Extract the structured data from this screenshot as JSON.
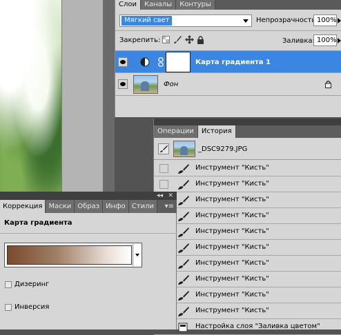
{
  "layers_panel": {
    "tabs": [
      "Слои",
      "Каналы",
      "Контуры"
    ],
    "blend_mode": "Мягкий свет",
    "opacity_label": "Непрозрачность:",
    "opacity_value": "100%",
    "lock_label": "Закрепить:",
    "fill_label": "Заливка:",
    "fill_value": "100%",
    "layers": [
      {
        "name": "Карта градиента 1",
        "selected": true
      },
      {
        "name": "Фон",
        "selected": false,
        "locked": true
      }
    ]
  },
  "history_panel": {
    "tabs": [
      "Операции",
      "История"
    ],
    "snapshot_name": "_DSC9279.JPG",
    "items": [
      "Инструмент \"Кисть\"",
      "Инструмент \"Кисть\"",
      "Инструмент \"Кисть\"",
      "Инструмент \"Кисть\"",
      "Инструмент \"Кисть\"",
      "Инструмент \"Кисть\"",
      "Инструмент \"Кисть\"",
      "Инструмент \"Кисть\"",
      "Инструмент \"Кисть\"",
      "Инструмент \"Кисть\"",
      "Настройка слоя \"Заливка цветом\""
    ]
  },
  "correction_panel": {
    "tabs": [
      "Коррекция",
      "Маски",
      "Образ",
      "Инфо",
      "Стили"
    ],
    "title": "Карта градиента",
    "dithering_label": "Дизеринг",
    "invert_label": "Инверсия"
  },
  "colors": {
    "selection": "#3a86e0",
    "panel_bg": "#d6d6d6",
    "dark_chrome": "#535353"
  }
}
